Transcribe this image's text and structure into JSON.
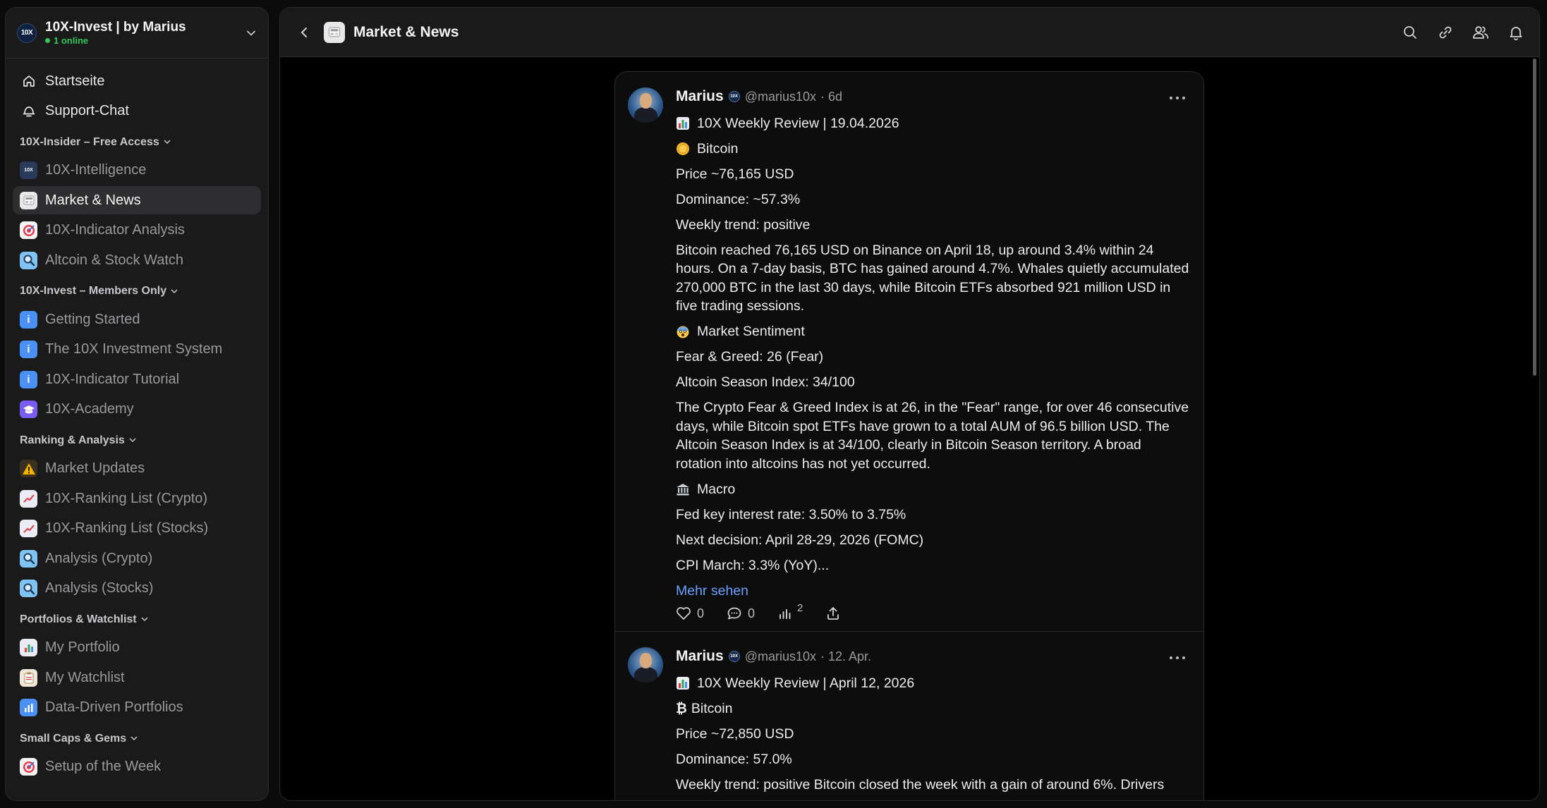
{
  "workspace": {
    "logo_text": "10X",
    "name": "10X-Invest | by Marius",
    "online": "1 online"
  },
  "nav": {
    "top": [
      {
        "label": "Startseite",
        "icon": "home-icon"
      },
      {
        "label": "Support-Chat",
        "icon": "support-icon"
      }
    ],
    "sections": [
      {
        "title": "10X-Insider – Free Access",
        "items": [
          {
            "label": "10X-Intelligence",
            "icon": "10x-logo-icon",
            "color": "#2b3a5a"
          },
          {
            "label": "Market & News",
            "icon": "newspaper-icon",
            "color": "#e8e8ea",
            "active": true
          },
          {
            "label": "10X-Indicator Analysis",
            "icon": "target-icon",
            "color": "#f2f2f4"
          },
          {
            "label": "Altcoin & Stock Watch",
            "icon": "magnifier-icon",
            "color": "#7ec3f2"
          }
        ]
      },
      {
        "title": "10X-Invest – Members Only",
        "items": [
          {
            "label": "Getting Started",
            "icon": "info-icon",
            "color": "#4a90f5"
          },
          {
            "label": "The 10X Investment System",
            "icon": "info-icon",
            "color": "#4a90f5"
          },
          {
            "label": "10X-Indicator Tutorial",
            "icon": "info-icon",
            "color": "#4a90f5"
          },
          {
            "label": "10X-Academy",
            "icon": "graduation-cap-icon",
            "color": "#7b5cf0"
          }
        ]
      },
      {
        "title": "Ranking & Analysis",
        "items": [
          {
            "label": "Market Updates",
            "icon": "warning-icon",
            "color": "#f4b400"
          },
          {
            "label": "10X-Ranking List (Crypto)",
            "icon": "chart-up-icon",
            "color": "#e9ecf2"
          },
          {
            "label": "10X-Ranking List (Stocks)",
            "icon": "chart-up-icon",
            "color": "#e9ecf2"
          },
          {
            "label": "Analysis (Crypto)",
            "icon": "magnifier-icon",
            "color": "#7ec3f2"
          },
          {
            "label": "Analysis (Stocks)",
            "icon": "magnifier-icon",
            "color": "#7ec3f2"
          }
        ]
      },
      {
        "title": "Portfolios & Watchlist",
        "items": [
          {
            "label": "My Portfolio",
            "icon": "bar-chart-icon",
            "color": "#e9ecf2"
          },
          {
            "label": "My Watchlist",
            "icon": "clipboard-icon",
            "color": "#f0e7d8"
          },
          {
            "label": "Data-Driven Portfolios",
            "icon": "bar-chart-blue-icon",
            "color": "#4a90f5"
          }
        ]
      },
      {
        "title": "Small Caps & Gems",
        "items": [
          {
            "label": "Setup of the Week",
            "icon": "target-icon",
            "color": "#f2f2f4"
          }
        ]
      }
    ]
  },
  "header": {
    "title": "Market & News",
    "icon": "newspaper-icon"
  },
  "toolbar": [
    "search-icon",
    "link-icon",
    "members-icon",
    "bell-icon"
  ],
  "posts": [
    {
      "author": "Marius",
      "badge": "10X",
      "handle": "@marius10x",
      "time": "· 6d",
      "lines": [
        {
          "emoji": "bar-chart-icon",
          "text": "10X Weekly Review | 19.04.2026"
        },
        {
          "emoji": "coin-icon",
          "text": "Bitcoin"
        },
        {
          "text": "Price ~76,165 USD"
        },
        {
          "text": "Dominance: ~57.3%"
        },
        {
          "text": "Weekly trend: positive"
        },
        {
          "text": "Bitcoin reached 76,165 USD on Binance on April 18, up around 3.4% within 24 hours. On a 7-day basis, BTC has gained around 4.7%. Whales quietly accumulated 270,000 BTC in the last 30 days, while Bitcoin ETFs absorbed 921 million USD in five trading sessions."
        },
        {
          "emoji": "scared-face-icon",
          "text": "Market Sentiment"
        },
        {
          "text": "Fear & Greed: 26 (Fear)"
        },
        {
          "text": "Altcoin Season Index: 34/100"
        },
        {
          "text": "The Crypto Fear & Greed Index is at 26, in the \"Fear\" range, for over 46 consecutive days, while Bitcoin spot ETFs have grown to a total AUM of 96.5 billion USD. The Altcoin Season Index is at 34/100, clearly in Bitcoin Season territory. A broad rotation into altcoins has not yet occurred."
        },
        {
          "emoji": "bank-icon",
          "text": "Macro"
        },
        {
          "text": "Fed key interest rate: 3.50% to 3.75%"
        },
        {
          "text": "Next decision: April 28-29, 2026 (FOMC)"
        },
        {
          "text": "CPI March: 3.3% (YoY)..."
        }
      ],
      "more_label": "Mehr sehen",
      "likes": "0",
      "comments": "0",
      "views": "2"
    },
    {
      "author": "Marius",
      "badge": "10X",
      "handle": "@marius10x",
      "time": "· 12. Apr.",
      "lines": [
        {
          "emoji": "bar-chart-icon",
          "text": "10X Weekly Review | April 12, 2026"
        },
        {
          "emoji": "bitcoin-symbol",
          "text": "Bitcoin"
        },
        {
          "text": "Price ~72,850 USD"
        },
        {
          "text": "Dominance: 57.0%"
        },
        {
          "text": "Weekly trend: positive Bitcoin closed the week with a gain of around 6%. Drivers"
        }
      ]
    }
  ]
}
